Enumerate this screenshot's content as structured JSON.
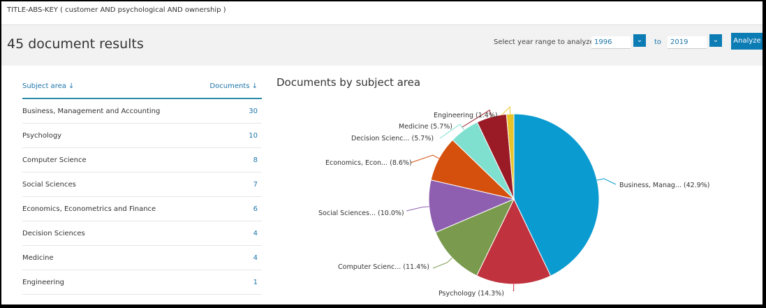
{
  "query": "TITLE-ABS-KEY ( customer  AND psychological  AND ownership )",
  "header": {
    "title": "45 document results",
    "range_label": "Select year range to analyze:",
    "year_from": "1996",
    "to_label": "to",
    "year_to": "2019",
    "analyze_label": "Analyze"
  },
  "table": {
    "col_subject": "Subject area ↓",
    "col_documents": "Documents ↓",
    "rows": [
      {
        "subject": "Business, Management and Accounting",
        "documents": "30"
      },
      {
        "subject": "Psychology",
        "documents": "10"
      },
      {
        "subject": "Computer Science",
        "documents": "8"
      },
      {
        "subject": "Social Sciences",
        "documents": "7"
      },
      {
        "subject": "Economics, Econometrics and Finance",
        "documents": "6"
      },
      {
        "subject": "Decision Sciences",
        "documents": "4"
      },
      {
        "subject": "Medicine",
        "documents": "4"
      },
      {
        "subject": "Engineering",
        "documents": "1"
      }
    ]
  },
  "chart_data": {
    "type": "pie",
    "title": "Documents by subject area",
    "slices": [
      {
        "label": "Business, Manag... (42.9%)",
        "value": 42.9,
        "color": "#0a9bd0"
      },
      {
        "label": "Psychology (14.3%)",
        "value": 14.3,
        "color": "#c0333e"
      },
      {
        "label": "Computer Scienc... (11.4%)",
        "value": 11.4,
        "color": "#7a9a4e"
      },
      {
        "label": "Social Sciences... (10.0%)",
        "value": 10.0,
        "color": "#8e5fb0"
      },
      {
        "label": "Economics, Econ... (8.6%)",
        "value": 8.6,
        "color": "#d4500c"
      },
      {
        "label": "Decision Scienc... (5.7%)",
        "value": 5.7,
        "color": "#7fe0d0"
      },
      {
        "label": "Medicine (5.7%)",
        "value": 5.7,
        "color": "#9a1a26"
      },
      {
        "label": "Engineering (1.4%)",
        "value": 1.4,
        "color": "#e8c42a"
      }
    ]
  }
}
